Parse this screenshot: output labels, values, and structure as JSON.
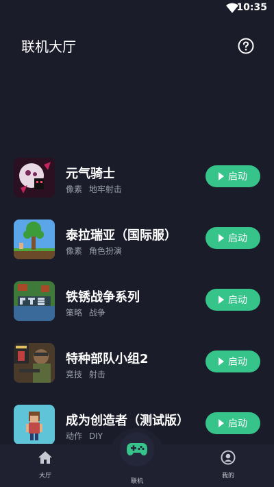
{
  "status_bar": {
    "time": "10:35",
    "wifi_icon": "wifi-icon"
  },
  "header": {
    "title": "联机大厅",
    "help_icon": "help-circle-icon"
  },
  "games": [
    {
      "name": "元气骑士",
      "tags": [
        "像素",
        "地牢射击"
      ],
      "button": "启动",
      "icon": "soul-knight-icon"
    },
    {
      "name": "泰拉瑞亚（国际服）",
      "tags": [
        "像素",
        "角色扮演"
      ],
      "button": "启动",
      "icon": "terraria-icon"
    },
    {
      "name": "铁锈战争系列",
      "tags": [
        "策略",
        "战争"
      ],
      "button": "启动",
      "icon": "rusted-warfare-icon"
    },
    {
      "name": "特种部队小组2",
      "tags": [
        "竞技",
        "射击"
      ],
      "button": "启动",
      "icon": "special-forces-icon"
    },
    {
      "name": "成为创造者（测试版）",
      "tags": [
        "动作",
        "DIY"
      ],
      "button": "启动",
      "icon": "creator-icon"
    }
  ],
  "bottom_nav": {
    "lobby": "大厅",
    "online": "联机",
    "mine": "我的"
  },
  "colors": {
    "background": "#1b1c29",
    "accent": "#36c48b",
    "tag_text": "#9aa0ae"
  }
}
